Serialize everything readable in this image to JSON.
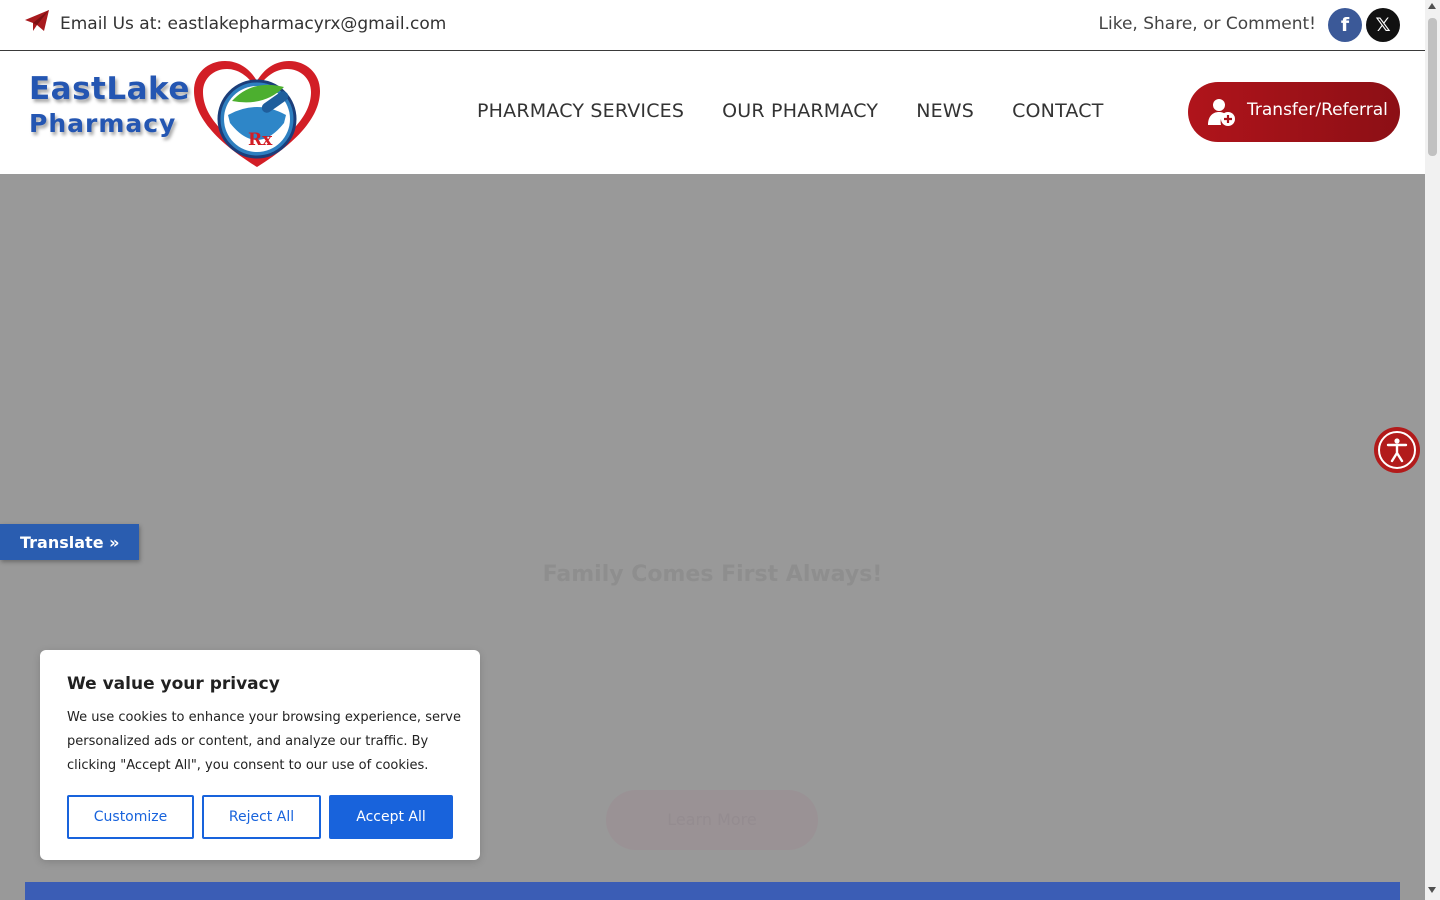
{
  "topbar": {
    "email_text": "Email Us at: eastlakepharmacyrx@gmail.com",
    "social_text": "Like, Share, or Comment!",
    "facebook_glyph": "f",
    "x_glyph": "𝕏",
    "icons": [
      "paper-plane-icon",
      "facebook-icon",
      "x-twitter-icon"
    ]
  },
  "logo": {
    "line1": "EastLake",
    "line2": "Pharmacy",
    "rx": "Rx"
  },
  "nav": {
    "items": [
      {
        "label": "PHARMACY SERVICES"
      },
      {
        "label": "OUR PHARMACY"
      },
      {
        "label": "NEWS"
      },
      {
        "label": "CONTACT"
      }
    ]
  },
  "cta": {
    "label": "Transfer/Referral",
    "color": "#a8121a"
  },
  "hero": {
    "tagline": "Family Comes First Always!",
    "button_label": "Learn More"
  },
  "translate": {
    "label": "Translate »"
  },
  "cookie": {
    "title": "We value your privacy",
    "text": "We use cookies to enhance your browsing experience, serve personalized ads or content, and analyze our traffic. By clicking \"Accept All\", you consent to our use of cookies.",
    "customize": "Customize",
    "reject": "Reject All",
    "accept": "Accept All",
    "accent": "#1863dc"
  },
  "colors": {
    "brand_blue": "#2456b2",
    "brand_red": "#b0141b",
    "overlay": "#999999"
  }
}
